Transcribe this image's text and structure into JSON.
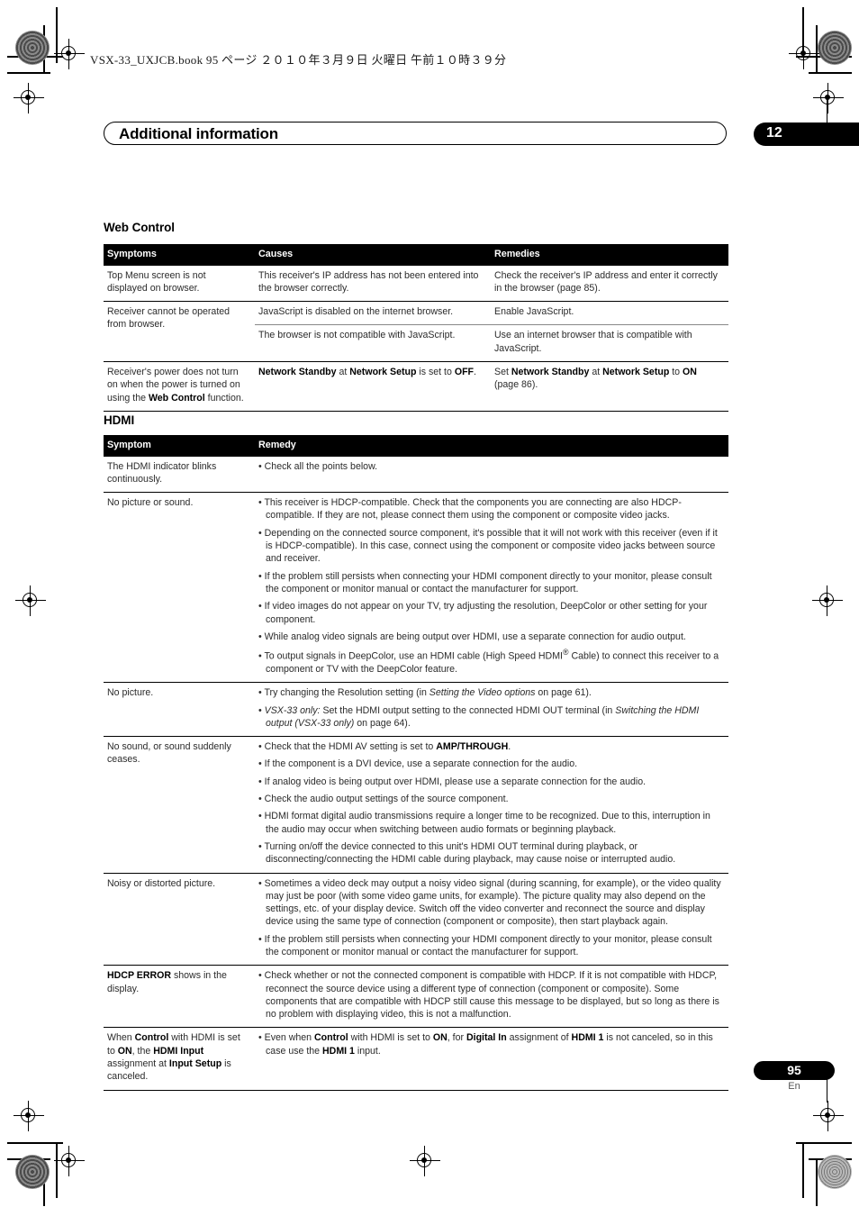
{
  "print_header": "VSX-33_UXJCB.book   95 ページ   ２０１０年３月９日   火曜日   午前１０時３９分",
  "chapter": {
    "title": "Additional information",
    "number": "12"
  },
  "footer": {
    "page_number": "95",
    "language": "En"
  },
  "sections": [
    {
      "heading": "Web Control",
      "columns": [
        "Symptoms",
        "Causes",
        "Remedies"
      ],
      "rows": [
        {
          "symptom": "Top Menu screen is not displayed on browser.",
          "causes": "This receiver's IP address has not been entered into the browser correctly.",
          "remedies": "Check the receiver's IP address and enter it correctly in the browser (page 85)."
        },
        {
          "symptom": "Receiver cannot be operated from browser.",
          "causes": "JavaScript is disabled on the internet browser.",
          "remedies": "Enable JavaScript."
        },
        {
          "symptom": "",
          "causes": "The browser is not compatible with JavaScript.",
          "remedies": "Use an internet browser that is compatible with JavaScript."
        },
        {
          "symptom_html": "Receiver's power does not turn on when the power is turned on using the <b>Web Control</b> function.",
          "causes_html": "<b>Network Standby</b> at <b>Network Setup</b> is set to <b>OFF</b>.",
          "remedies_html": "Set <b>Network Standby</b> at <b>Network Setup</b> to <b>ON</b> (page 86)."
        }
      ]
    },
    {
      "heading": "HDMI",
      "columns": [
        "Symptom",
        "Remedy"
      ],
      "rows": [
        {
          "symptom": "The HDMI indicator blinks continuously.",
          "remedies_items": [
            "Check all the points below."
          ]
        },
        {
          "symptom": "No picture or sound.",
          "remedies_items": [
            "This receiver is HDCP-compatible. Check that the components you are connecting are also HDCP-compatible. If they are not, please connect them using the component or composite video jacks.",
            "Depending on the connected source component, it's possible that it will not work with this receiver (even if it is HDCP-compatible). In this case, connect using the component or composite video jacks between source and receiver.",
            "If the problem still persists when connecting your HDMI component directly to your monitor, please consult the component or monitor manual or contact the manufacturer for support.",
            "If video images do not appear on your TV, try adjusting the resolution, DeepColor or other setting for your component.",
            "While analog video signals are being output over HDMI, use a separate connection for audio output.",
            "To output signals in DeepColor, use an HDMI cable (High Speed HDMI<sup>&#174;</sup> Cable) to connect this receiver to a component or TV with the DeepColor feature."
          ]
        },
        {
          "symptom": "No picture.",
          "remedies_items": [
            "Try changing the Resolution setting (in <i>Setting the Video options</i> on page 61).",
            "<i>VSX-33 only:</i> Set the HDMI output setting to the connected HDMI OUT terminal (in <i>Switching the HDMI output (VSX-33 only)</i> on page 64)."
          ]
        },
        {
          "symptom": "No sound, or sound suddenly ceases.",
          "remedies_items": [
            "Check that the HDMI AV setting is set to <b>AMP/THROUGH</b>.",
            "If the component is a DVI device, use a separate connection for the audio.",
            "If analog video is being output over HDMI, please use a separate connection for the audio.",
            "Check the audio output settings of the source component.",
            "HDMI format digital audio transmissions require a longer time to be recognized. Due to this, interruption in the audio may occur when switching between audio formats or beginning playback.",
            "Turning on/off the device connected to this unit's HDMI OUT terminal during playback, or disconnecting/connecting the HDMI cable during playback, may cause noise or interrupted audio."
          ]
        },
        {
          "symptom": "Noisy or distorted picture.",
          "remedies_items": [
            "Sometimes a video deck may output a noisy video signal (during scanning, for example), or the video quality may just be poor (with some video game units, for example). The picture quality may also depend on the settings, etc. of your display device. Switch off the video converter and reconnect the source and display device using the same type of connection (component or composite), then start playback again.",
            "If the problem still persists when connecting your HDMI component directly to your monitor, please consult the component or monitor manual or contact the manufacturer for support."
          ]
        },
        {
          "symptom_html": "<b>HDCP ERROR</b> shows in the display.",
          "remedies_items": [
            "Check whether or not the connected component is compatible with HDCP. If it is not compatible with HDCP, reconnect the source device using a different type of connection (component or composite). Some components that are compatible with HDCP still cause this message to be displayed, but so long as there is no problem with displaying video, this is not a malfunction."
          ]
        },
        {
          "symptom_html": "When <b>Control</b> with HDMI is set to <b>ON</b>, the <b>HDMI Input</b> assignment at <b>Input Setup</b> is canceled.",
          "remedies_items": [
            "Even when <b>Control</b> with HDMI is set to <b>ON</b>, for <b>Digital In</b> assignment of <b>HDMI 1</b> is not canceled, so in this case use the <b>HDMI 1</b> input."
          ]
        }
      ]
    }
  ]
}
